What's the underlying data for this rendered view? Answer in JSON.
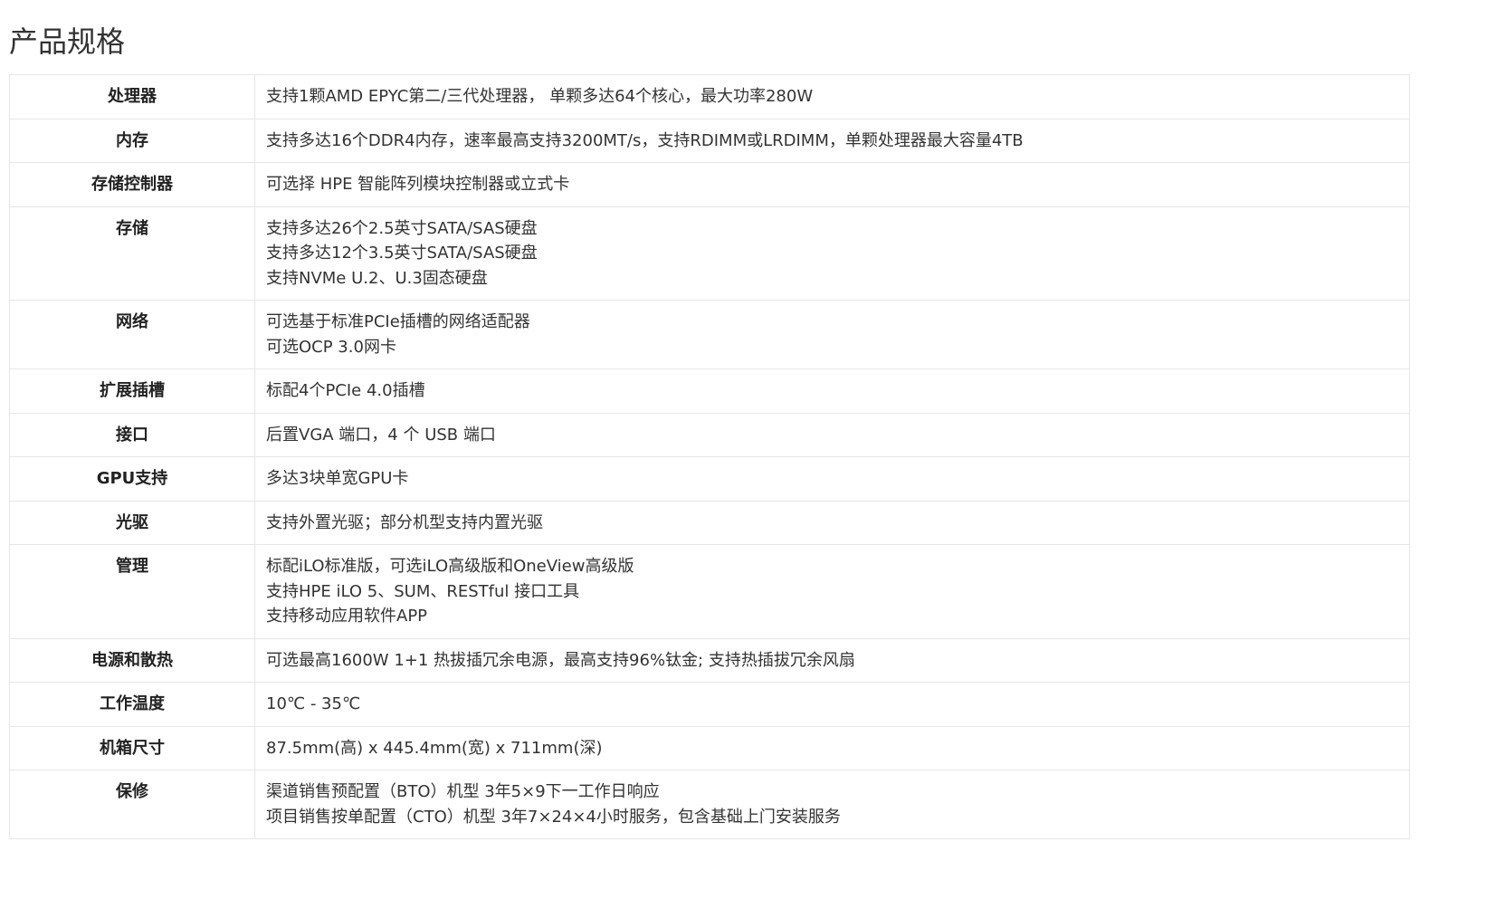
{
  "page_title": "产品规格",
  "specs": [
    {
      "label": "处理器",
      "lines": [
        "支持1颗AMD EPYC第二/三代处理器， 单颗多达64个核心，最大功率280W"
      ]
    },
    {
      "label": "内存",
      "lines": [
        "支持多达16个DDR4内存，速率最高支持3200MT/s，支持RDIMM或LRDIMM，单颗处理器最大容量4TB"
      ]
    },
    {
      "label": "存储控制器",
      "lines": [
        "可选择 HPE 智能阵列模块控制器或立式卡"
      ]
    },
    {
      "label": "存储",
      "lines": [
        "支持多达26个2.5英寸SATA/SAS硬盘",
        "支持多达12个3.5英寸SATA/SAS硬盘",
        "支持NVMe U.2、U.3固态硬盘"
      ]
    },
    {
      "label": "网络",
      "lines": [
        "可选基于标准PCIe插槽的网络适配器",
        "可选OCP 3.0网卡"
      ]
    },
    {
      "label": "扩展插槽",
      "lines": [
        "标配4个PCIe 4.0插槽"
      ]
    },
    {
      "label": "接口",
      "lines": [
        "后置VGA 端口，4 个 USB 端口"
      ]
    },
    {
      "label": "GPU支持",
      "lines": [
        "多达3块单宽GPU卡"
      ]
    },
    {
      "label": "光驱",
      "lines": [
        "支持外置光驱；部分机型支持内置光驱"
      ]
    },
    {
      "label": "管理",
      "lines": [
        "标配iLO标准版，可选iLO高级版和OneView高级版",
        "支持HPE iLO 5、SUM、RESTful 接口工具",
        "支持移动应用软件APP"
      ]
    },
    {
      "label": "电源和散热",
      "lines": [
        "可选最高1600W 1+1 热拔插冗余电源，最高支持96%钛金; 支持热插拔冗余风扇"
      ]
    },
    {
      "label": "工作温度",
      "lines": [
        "10℃ - 35℃"
      ]
    },
    {
      "label": "机箱尺寸",
      "lines": [
        "87.5mm(高) x 445.4mm(宽) x 711mm(深)"
      ]
    },
    {
      "label": "保修",
      "lines": [
        "渠道销售预配置（BTO）机型 3年5×9下一工作日响应",
        "项目销售按单配置（CTO）机型 3年7×24×4小时服务，包含基础上门安装服务"
      ]
    }
  ]
}
